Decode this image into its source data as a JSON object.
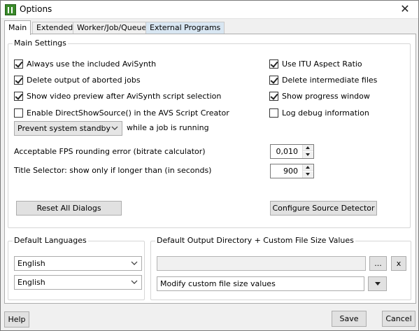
{
  "window": {
    "title": "Options",
    "close_glyph": "✕"
  },
  "tabs": [
    {
      "label": "Main",
      "active": true
    },
    {
      "label": "Extended"
    },
    {
      "label": "Worker/Job/Queue"
    },
    {
      "label": "External Programs",
      "hovered": true
    }
  ],
  "main_settings": {
    "group_label": "Main Settings",
    "left_checks": [
      {
        "label": "Always use the included AviSynth",
        "checked": true
      },
      {
        "label": "Delete output of aborted jobs",
        "checked": true
      },
      {
        "label": "Show video preview after AviSynth script selection",
        "checked": true
      },
      {
        "label": "Enable DirectShowSource() in the AVS Script Creator",
        "checked": false
      }
    ],
    "right_checks": [
      {
        "label": "Use ITU Aspect Ratio",
        "checked": true
      },
      {
        "label": "Delete intermediate files",
        "checked": true
      },
      {
        "label": "Show progress window",
        "checked": true
      },
      {
        "label": "Log debug information",
        "checked": false
      }
    ],
    "standby_combo": "Prevent system standby",
    "standby_suffix": "while a job is running",
    "fps_label": "Acceptable FPS rounding error (bitrate calculator)",
    "fps_value": "0,010",
    "title_label": "Title Selector:  show only if longer than (in seconds)",
    "title_value": "900",
    "reset_button": "Reset All Dialogs",
    "configure_button": "Configure Source Detector"
  },
  "default_languages": {
    "group_label": "Default Languages",
    "lang1": "English",
    "lang2": "English"
  },
  "output_dir": {
    "group_label": "Default Output Directory + Custom File Size Values",
    "path_value": "",
    "browse_label": "...",
    "clear_label": "x",
    "filesize_combo": "Modify custom file size values"
  },
  "footer": {
    "help": "Help",
    "save": "Save",
    "cancel": "Cancel"
  },
  "colors": {
    "tab_hover": "#d8e6f2",
    "app_icon": "#3a8a2a"
  }
}
